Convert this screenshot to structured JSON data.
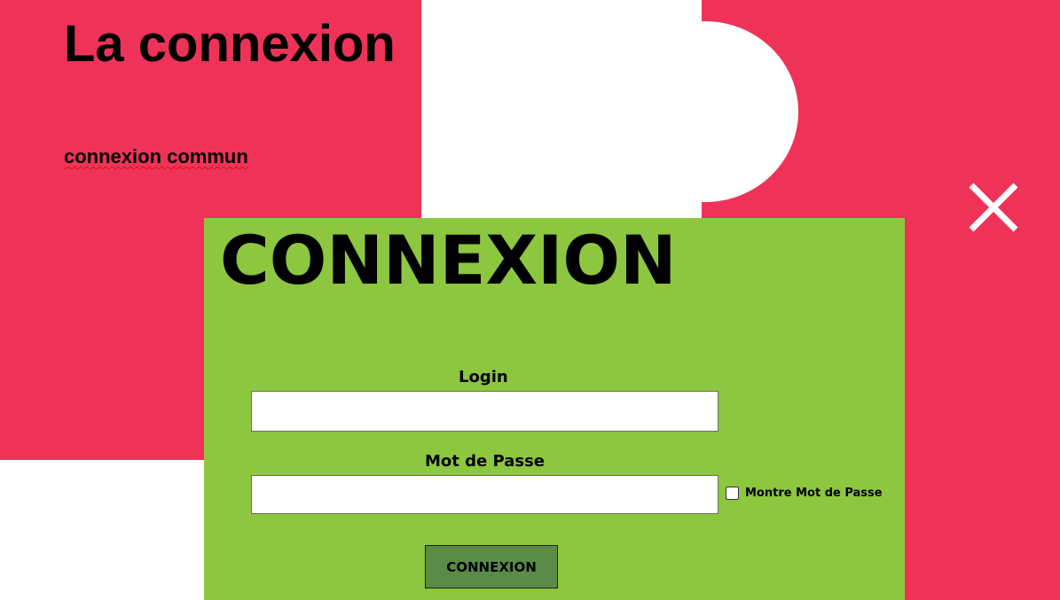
{
  "page": {
    "title": "La connexion",
    "subtitle": "connexion commun"
  },
  "close_icon": "close-icon",
  "panel": {
    "heading": "CONNEXION",
    "login_label": "Login",
    "login_value": "",
    "password_label": "Mot de Passe",
    "password_value": "",
    "show_password_label": "Montre Mot de Passe",
    "show_password_checked": false,
    "submit_label": "CONNEXION"
  },
  "colors": {
    "accent_background": "#ef3358",
    "panel_background": "#8dc63f",
    "button_background": "#5a8c47",
    "close_icon": "#ffffff"
  }
}
